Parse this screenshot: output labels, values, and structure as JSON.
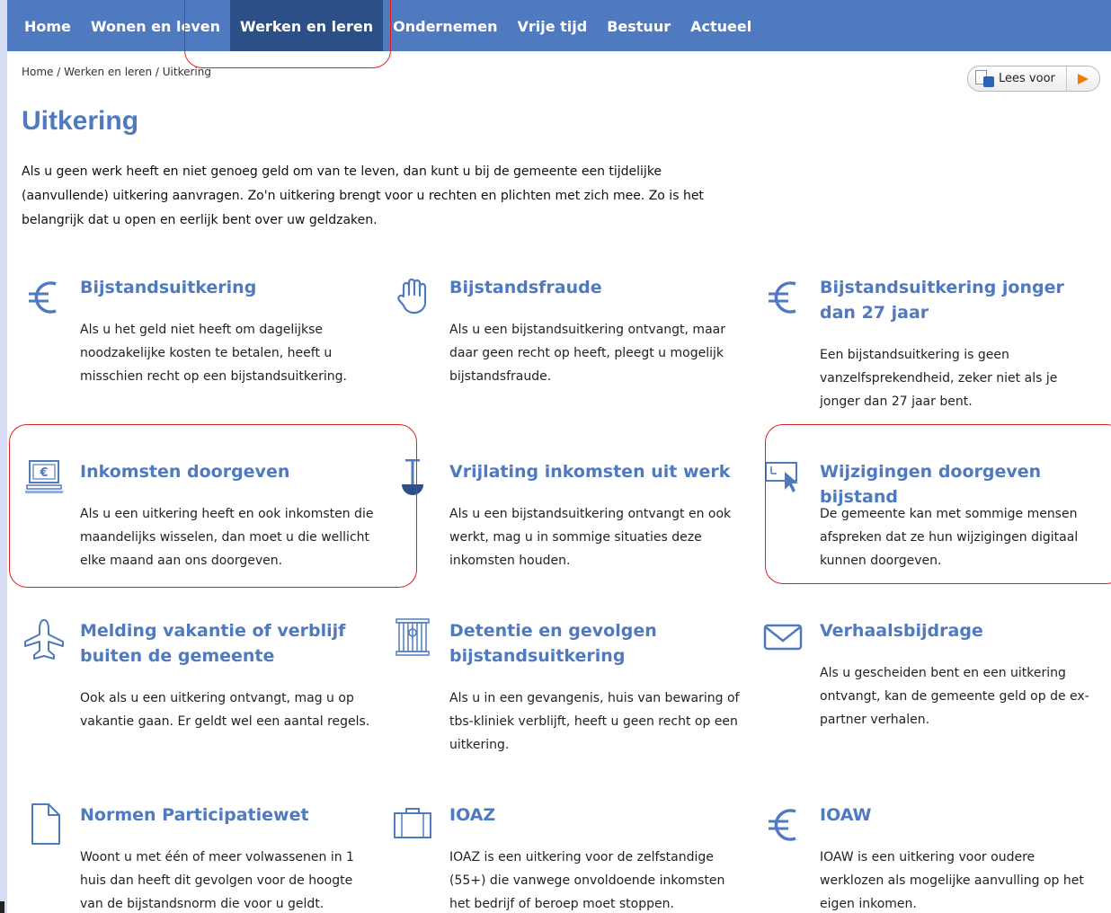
{
  "nav": {
    "items": [
      {
        "label": "Home"
      },
      {
        "label": "Wonen en leven"
      },
      {
        "label": "Werken en leren",
        "active": true
      },
      {
        "label": "Ondernemen"
      },
      {
        "label": "Vrije tijd"
      },
      {
        "label": "Bestuur"
      },
      {
        "label": "Actueel"
      }
    ]
  },
  "breadcrumb": "Home / Werken en leren / Uitkering",
  "read_aloud": {
    "label": "Lees voor"
  },
  "page": {
    "title": "Uitkering",
    "intro": "Als u geen werk heeft en niet genoeg geld om van te leven, dan kunt u bij de gemeente een tijdelijke (aanvullende) uitkering aanvragen. Zo'n uitkering brengt voor u rechten en plichten met zich mee. Zo is het belangrijk dat u open en eerlijk bent over uw geldzaken."
  },
  "cards": [
    {
      "icon": "euro-icon",
      "title": "Bijstandsuitkering",
      "desc": "Als u het geld niet heeft om dagelijkse noodzakelijke kosten te betalen, heeft u misschien recht op een bijstandsuitkering."
    },
    {
      "icon": "hand-icon",
      "title": "Bijstandsfraude",
      "desc": "Als u een bijstandsuitkering ontvangt, maar daar geen recht op heeft, pleegt u mogelijk bijstandsfraude."
    },
    {
      "icon": "euro-icon",
      "title": "Bijstandsuitkering jonger dan 27 jaar",
      "desc": "Een bijstandsuitkering is geen vanzelfsprekendheid, zeker niet als je jonger dan 27 jaar bent."
    },
    {
      "icon": "computer-euro-icon",
      "title": "Inkomsten doorgeven",
      "desc": "Als u een uitkering heeft en ook inkomsten die maandelijks wisselen, dan moet u die wellicht elke maand aan ons doorgeven."
    },
    {
      "icon": "scale-icon",
      "title": "Vrijlating inkomsten uit werk",
      "desc": "Als u een bijstandsuitkering ontvangt en ook werkt, mag u in sommige situaties deze inkomsten houden."
    },
    {
      "icon": "screen-cursor-icon",
      "title": "Wijzigingen doorgeven bijstand",
      "desc": "De gemeente kan met sommige mensen afspreken dat ze hun wijzigingen digitaal kunnen doorgeven."
    },
    {
      "icon": "airplane-icon",
      "title": "Melding vakantie of verblijf buiten de gemeente",
      "desc": "Ook als u een uitkering ontvangt, mag u op vakantie gaan. Er geldt wel een aantal regels."
    },
    {
      "icon": "prison-icon",
      "title": "Detentie en gevolgen bijstandsuitkering",
      "desc": "Als u in een gevangenis, huis van bewaring of  tbs-kliniek verblijft, heeft u geen recht op een uitkering."
    },
    {
      "icon": "envelope-icon",
      "title": "Verhaalsbijdrage",
      "desc": "Als u gescheiden bent en een uitkering ontvangt, kan de gemeente geld op de ex-partner verhalen."
    },
    {
      "icon": "document-icon",
      "title": "Normen Participatiewet",
      "desc": "Woont u met één of meer volwassenen in 1 huis dan heeft dit gevolgen voor de hoogte van de bijstandsnorm die voor u geldt."
    },
    {
      "icon": "briefcase-icon",
      "title": "IOAZ",
      "desc": "IOAZ is een uitkering voor de zelfstandige (55+) die vanwege onvoldoende inkomsten het bedrijf of beroep moet stoppen."
    },
    {
      "icon": "euro-icon",
      "title": "IOAW",
      "desc": "IOAW is een uitkering voor oudere werklozen als mogelijke aanvulling op het eigen inkomen."
    }
  ],
  "colors": {
    "nav": "#4f7ac0",
    "nav_active": "#2d4f87",
    "accent": "#4f7ac0",
    "callout": "#e02020"
  }
}
